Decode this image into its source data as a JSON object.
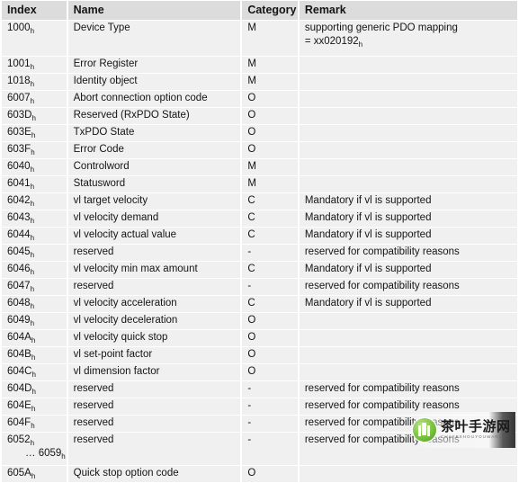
{
  "table": {
    "columns": [
      {
        "key": "index",
        "label": "Index"
      },
      {
        "key": "name",
        "label": "Name"
      },
      {
        "key": "category",
        "label": "Category"
      },
      {
        "key": "remark",
        "label": "Remark"
      }
    ],
    "rows": [
      {
        "index": "1000",
        "index_sub": "h",
        "name": "Device Type",
        "category": "M",
        "remark": "supporting generic PDO mapping",
        "remark2": "= xx020192",
        "remark2_sub": "h"
      },
      {
        "index": "1001",
        "index_sub": "h",
        "name": "Error Register",
        "category": "M",
        "remark": ""
      },
      {
        "index": "1018",
        "index_sub": "h",
        "name": "Identity object",
        "category": "M",
        "remark": ""
      },
      {
        "index": "6007",
        "index_sub": "h",
        "name": "Abort connection option code",
        "category": "O",
        "remark": ""
      },
      {
        "index": "603D",
        "index_sub": "h",
        "name": "Reserved (RxPDO State)",
        "category": "O",
        "remark": ""
      },
      {
        "index": "603E",
        "index_sub": "h",
        "name": "TxPDO State",
        "category": "O",
        "remark": ""
      },
      {
        "index": "603F",
        "index_sub": "h",
        "name": "Error Code",
        "category": "O",
        "remark": ""
      },
      {
        "index": "6040",
        "index_sub": "h",
        "name": "Controlword",
        "category": "M",
        "remark": ""
      },
      {
        "index": "6041",
        "index_sub": "h",
        "name": "Statusword",
        "category": "M",
        "remark": ""
      },
      {
        "index": "6042",
        "index_sub": "h",
        "name": "vl target velocity",
        "category": "C",
        "remark": "Mandatory if vl is supported"
      },
      {
        "index": "6043",
        "index_sub": "h",
        "name": "vl velocity demand",
        "category": "C",
        "remark": "Mandatory if vl is supported"
      },
      {
        "index": "6044",
        "index_sub": "h",
        "name": "vl velocity actual value",
        "category": "C",
        "remark": "Mandatory if vl is supported"
      },
      {
        "index": "6045",
        "index_sub": "h",
        "name": "reserved",
        "category": "-",
        "remark": "reserved for compatibility reasons"
      },
      {
        "index": "6046",
        "index_sub": "h",
        "name": "vl velocity min max amount",
        "category": "C",
        "remark": "Mandatory if vl is supported"
      },
      {
        "index": "6047",
        "index_sub": "h",
        "name": "reserved",
        "category": "-",
        "remark": "reserved for compatibility reasons"
      },
      {
        "index": "6048",
        "index_sub": "h",
        "name": "vl velocity acceleration",
        "category": "C",
        "remark": "Mandatory if vl is supported"
      },
      {
        "index": "6049",
        "index_sub": "h",
        "name": "vl velocity deceleration",
        "category": "O",
        "remark": ""
      },
      {
        "index": "604A",
        "index_sub": "h",
        "name": "vl velocity quick stop",
        "category": "O",
        "remark": ""
      },
      {
        "index": "604B",
        "index_sub": "h",
        "name": "vl set-point factor",
        "category": "O",
        "remark": ""
      },
      {
        "index": "604C",
        "index_sub": "h",
        "name": "vl dimension factor",
        "category": "O",
        "remark": ""
      },
      {
        "index": "604D",
        "index_sub": "h",
        "name": "reserved",
        "category": "-",
        "remark": "reserved for compatibility reasons"
      },
      {
        "index": "604E",
        "index_sub": "h",
        "name": "reserved",
        "category": "-",
        "remark": "reserved for compatibility reasons"
      },
      {
        "index": "604F",
        "index_sub": "h",
        "name": "reserved",
        "category": "-",
        "remark": "reserved for compatibility reasons"
      },
      {
        "index": "6052",
        "index_sub": "h",
        "index_cont": "… 6059",
        "index_cont_sub": "h",
        "name": "reserved",
        "category": "-",
        "remark": "reserved for compatibility reasons"
      },
      {
        "index": "605A",
        "index_sub": "h",
        "name": "Quick stop option code",
        "category": "O",
        "remark": ""
      }
    ]
  },
  "watermark": {
    "title": "茶叶手游网",
    "subtitle": "CHAYESHOUYOUWANG"
  },
  "colors": {
    "header_bg": "#dcdcdc",
    "cell_bg": "#f0f0f0",
    "page_bg": "#ffffff",
    "text": "#141414",
    "watermark_green": "#79c23c"
  }
}
